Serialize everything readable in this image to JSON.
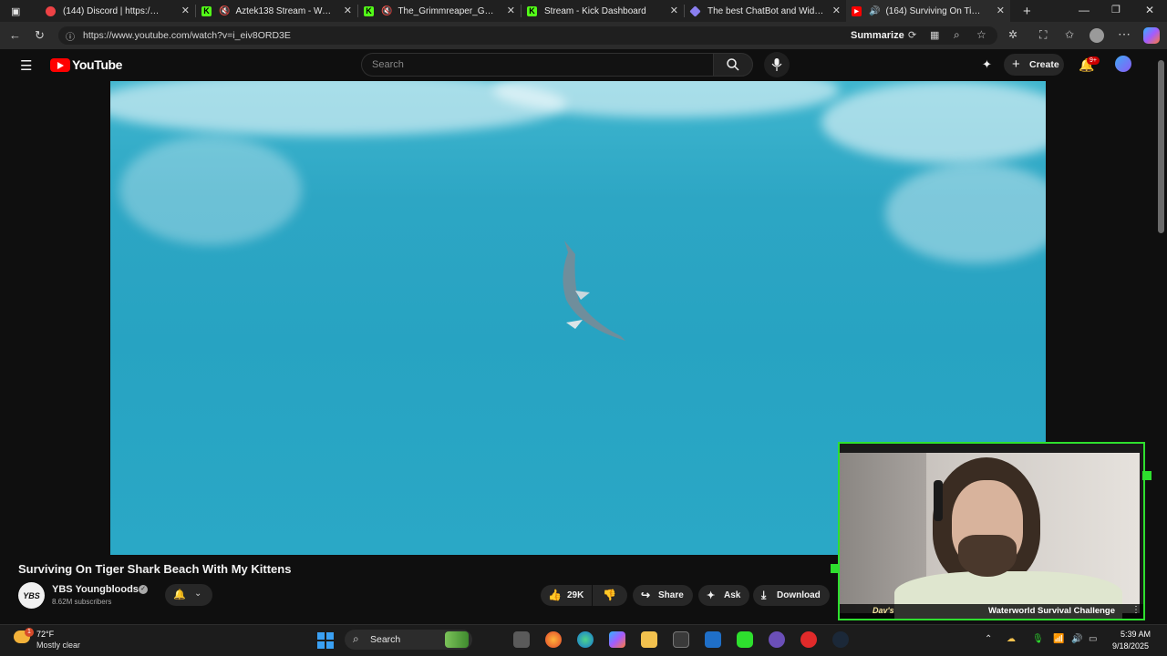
{
  "browser": {
    "tabs": [
      {
        "label": "(144) Discord | https://dis",
        "favicon": "discord-icon",
        "color": "#ed4245"
      },
      {
        "label": "Aztek138 Stream - Watch",
        "favicon": "kick-icon",
        "color": "#53fc18",
        "muted": true
      },
      {
        "label": "The_Grimmreaper_Gamin",
        "favicon": "kick-icon",
        "color": "#53fc18",
        "muted": true
      },
      {
        "label": "Stream - Kick Dashboard",
        "favicon": "kick-icon",
        "color": "#53fc18"
      },
      {
        "label": "The best ChatBot and Widgets",
        "favicon": "diamond-icon",
        "color": "#8a7ff0"
      },
      {
        "label": "(164) Surviving On Tiger",
        "favicon": "youtube-icon",
        "color": "#ff0000",
        "active": true,
        "audio": true
      }
    ],
    "url": "https://www.youtube.com/watch?v=i_eiv8ORD3E",
    "summarize_label": "Summarize"
  },
  "youtube": {
    "logo_text": "YouTube",
    "search_placeholder": "Search",
    "create_label": "Create",
    "notification_count": "9+"
  },
  "video": {
    "title": "Surviving On Tiger Shark Beach With My Kittens",
    "channel": "YBS Youngbloods",
    "avatar_text": "YBS",
    "subscribers": "8.62M subscribers",
    "likes": "29K",
    "share_label": "Share",
    "ask_label": "Ask",
    "download_label": "Download"
  },
  "webcam": {
    "caption": "Waterworld Survival Challenge",
    "name_tag": "Dav's"
  },
  "taskbar": {
    "temperature": "72°F",
    "weather": "Mostly clear",
    "weather_badge": "1",
    "search_label": "Search",
    "time": "5:39 AM",
    "date": "9/18/2025"
  },
  "colors": {
    "youtube_red": "#ff0000",
    "kick_green": "#53fc18",
    "overlay_border": "#2ee02e",
    "ocean": "#2da6c4"
  }
}
